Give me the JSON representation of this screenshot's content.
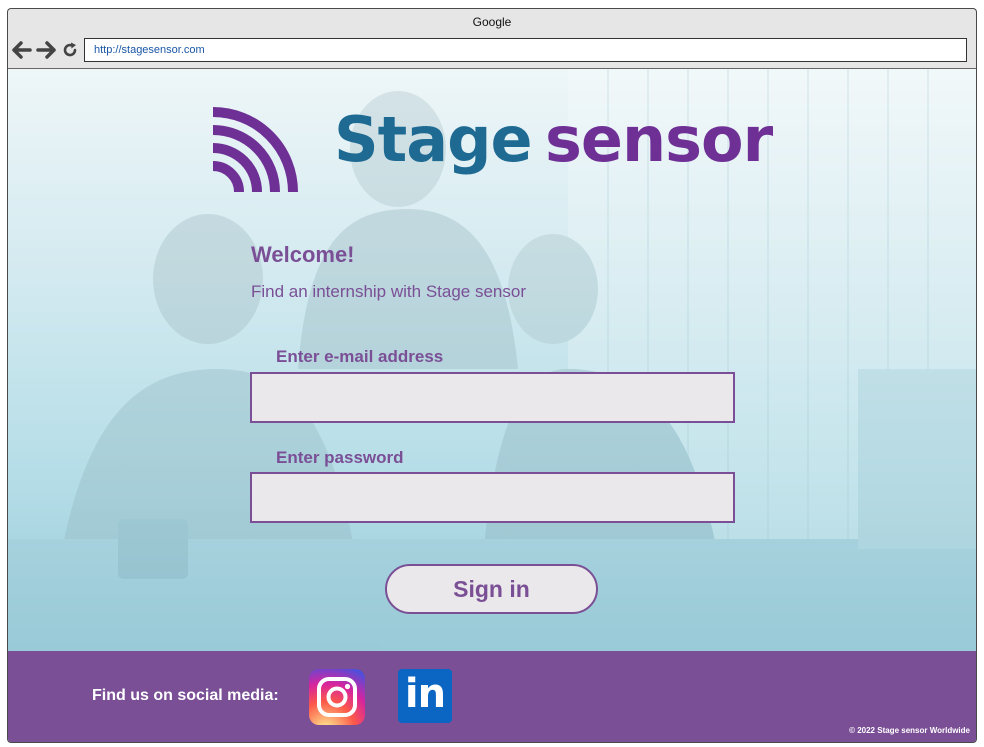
{
  "browser": {
    "title": "Google",
    "url": "http://stagesensor.com",
    "back_icon": "back-arrow-icon",
    "forward_icon": "forward-arrow-icon",
    "reload_icon": "reload-icon"
  },
  "brand": {
    "name_part1": "Stage",
    "name_part2": "sensor",
    "logo_icon": "signal-waves-icon",
    "colors": {
      "primary": "#1e6a92",
      "accent": "#6f3096"
    }
  },
  "login": {
    "heading": "Welcome!",
    "subheading": "Find an internship with Stage sensor",
    "email_label": "Enter e-mail address",
    "email_value": "",
    "password_label": "Enter password",
    "password_value": "",
    "signin_label": "Sign in"
  },
  "footer": {
    "social_label": "Find us on social media:",
    "instagram_icon": "instagram-icon",
    "linkedin_icon": "linkedin-icon",
    "linkedin_text": "in",
    "copyright": "© 2022 Stage sensor Worldwide",
    "color": "#7a4f96"
  }
}
